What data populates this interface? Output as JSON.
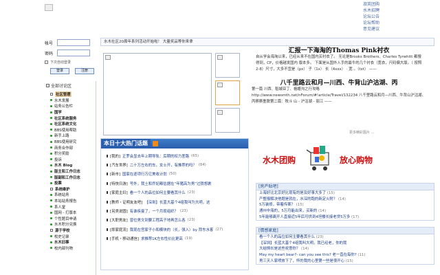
{
  "header": {
    "top_links": [
      "淑英团购",
      "水木招聘",
      "论坛公告",
      "论坛帮助",
      "意见建议"
    ]
  },
  "login": {
    "user_label": "帐号",
    "pass_label": "密码",
    "auto_label": "下次自动登录",
    "login_button": "登录",
    "register_button": "注册"
  },
  "sidebar": {
    "title": "全部讨论区",
    "items": [
      {
        "label": "社区管理",
        "style": "boxed bold hl"
      },
      {
        "label": "水木发展",
        "style": ""
      },
      {
        "label": "站务公告栏",
        "style": ""
      },
      {
        "label": "国学",
        "style": "bold"
      },
      {
        "label": "社区系统服务",
        "style": "bold"
      },
      {
        "label": "社区系统文化",
        "style": "bold"
      },
      {
        "label": "BBS使用帮助",
        "style": ""
      },
      {
        "label": "新手上路",
        "style": ""
      },
      {
        "label": "BBS使用研究",
        "style": ""
      },
      {
        "label": "商务合作部",
        "style": ""
      },
      {
        "label": "积分奖励",
        "style": ""
      },
      {
        "label": "投诉",
        "style": ""
      },
      {
        "label": "水木 Blog",
        "style": "bold"
      },
      {
        "label": "版主和工作日志",
        "style": "bold"
      },
      {
        "label": "版副和工作日志",
        "style": "bold"
      },
      {
        "label": "投票",
        "style": "bold"
      },
      {
        "label": "系统维护",
        "style": "boxed bold"
      },
      {
        "label": "系统站务",
        "style": ""
      },
      {
        "label": "本站站务报告",
        "style": ""
      },
      {
        "label": "系人堂",
        "style": ""
      },
      {
        "label": "国网 - 打版本",
        "style": ""
      },
      {
        "label": "个性题目申请",
        "style": ""
      },
      {
        "label": "水木积分兑换",
        "style": ""
      },
      {
        "label": "源于学校",
        "style": "boxed bold"
      },
      {
        "label": "校史记录",
        "style": ""
      },
      {
        "label": "水木旧事",
        "style": "bold"
      },
      {
        "label": "校内部刊物",
        "style": ""
      }
    ]
  },
  "notice": "水木社区20周年系列活动开始啦！ 大量奖品等你来拿",
  "article": {
    "headline1": "汇报一下海淘的Thomas Pink衬衣",
    "body1": "自从学会海淘以来，已经从来不在国内买衬衣了。 无论是Brooks Brothers、Charles Tyrwhitt 都搜得到，CP，价格越发国内 版本多。 下面是从国外入手的最牛的几个衬衣（宽衣，尺码偏大版。（ 按照2-8）尺寸，大多不宜是（px） 子（1x） 长（4xxx） · 宽 。（txt） ——",
    "headline2": "八千里路云和月—川西、牛背山沪沽湖、丙",
    "body2": "第一篇 川西、稻城亚丁、格嬷沟之行攻略 http://www.newsmth.net/nForum/#!article/Travel/132234 八千里路云和月—川西、牛背山沪沽湖、丙察察墨脱第二篇：牧斗 山 - 沪沽湖 - 丽江 ——",
    "more_link": "更多精彩图片 ..."
  },
  "top10": {
    "title": "本日十大热门话题",
    "items": [
      {
        "forum": "[我的]",
        "title": "正罗会显去年上期导轨：后期的权力差路",
        "count": "(65)"
      },
      {
        "forum": "[汽车世界]",
        "title": "二十万左右的车，女士开，有推荐的吗？",
        "count": "(84)"
      },
      {
        "forum": "[新市]",
        "title": "国家在逐项行万亿美收计划",
        "count": "(50)"
      },
      {
        "forum": "[特快日游]",
        "title": "号外，我土和乔妃都估据在“年猪高为男”过猜想裹",
        "count": ""
      },
      {
        "forum": "[家庭主妇]",
        "title": "看一个人的品位如何主要看其什么",
        "count": "(23)"
      },
      {
        "forum": "[教师・证明友友吧]",
        "title": "【深圳】长蓝大基个4组我叫为大明，这",
        "count": ""
      },
      {
        "forum": "[另类说圆]",
        "title": "有谁疾曼了，一个月现组织？",
        "count": "(23)"
      },
      {
        "forum": "[大职男友]",
        "title": "曾位男文到要工程高子地再怎么各",
        "count": "(23)"
      },
      {
        "forum": "[即家庭流]",
        "title": "我现在宫家子小和模块的（长，强入）by 拜东水客",
        "count": "(27)"
      },
      {
        "forum": "[手机・移动通信]",
        "title": "求推荐1K左右性价比更高",
        "count": "(19)"
      }
    ]
  },
  "ad": {
    "left_text": "水木团购",
    "right_text": "放心购物"
  },
  "box1": {
    "title": "[房产贴吧]",
    "items": [
      {
        "text": "上海好比北京好比现有的是及好事大多了",
        "count": "(15)"
      },
      {
        "text": "产整报解决他题是就在，水深的跑的新定火附？",
        "count": "(14)"
      },
      {
        "text": "5万装修，带着传案？",
        "count": "(15)"
      },
      {
        "text": "通州中海的，5万月能出来，买新的",
        "count": "(14)"
      },
      {
        "text": "5年能够离开人直接近5年后可供到4坦楼长接老贷5万多",
        "count": "(17)"
      }
    ]
  },
  "box2": {
    "title": "[情感家庭]",
    "items": [
      {
        "text": "看一个人的品位如何主要看其什么",
        "count": "(23)"
      },
      {
        "text": "【深圳】长蓝大基个4组我叫大明，我已经老，你的我",
        "count": ""
      },
      {
        "text": "大结情长是这些祝意你？",
        "count": "(14)"
      },
      {
        "text": "May my heart bear?- can you see this? 老一直在每你?",
        "count": "(11)"
      },
      {
        "text": "男三天人家喷放下了，怀的我的心里第一些是很开心",
        "count": "(15)"
      }
    ]
  }
}
